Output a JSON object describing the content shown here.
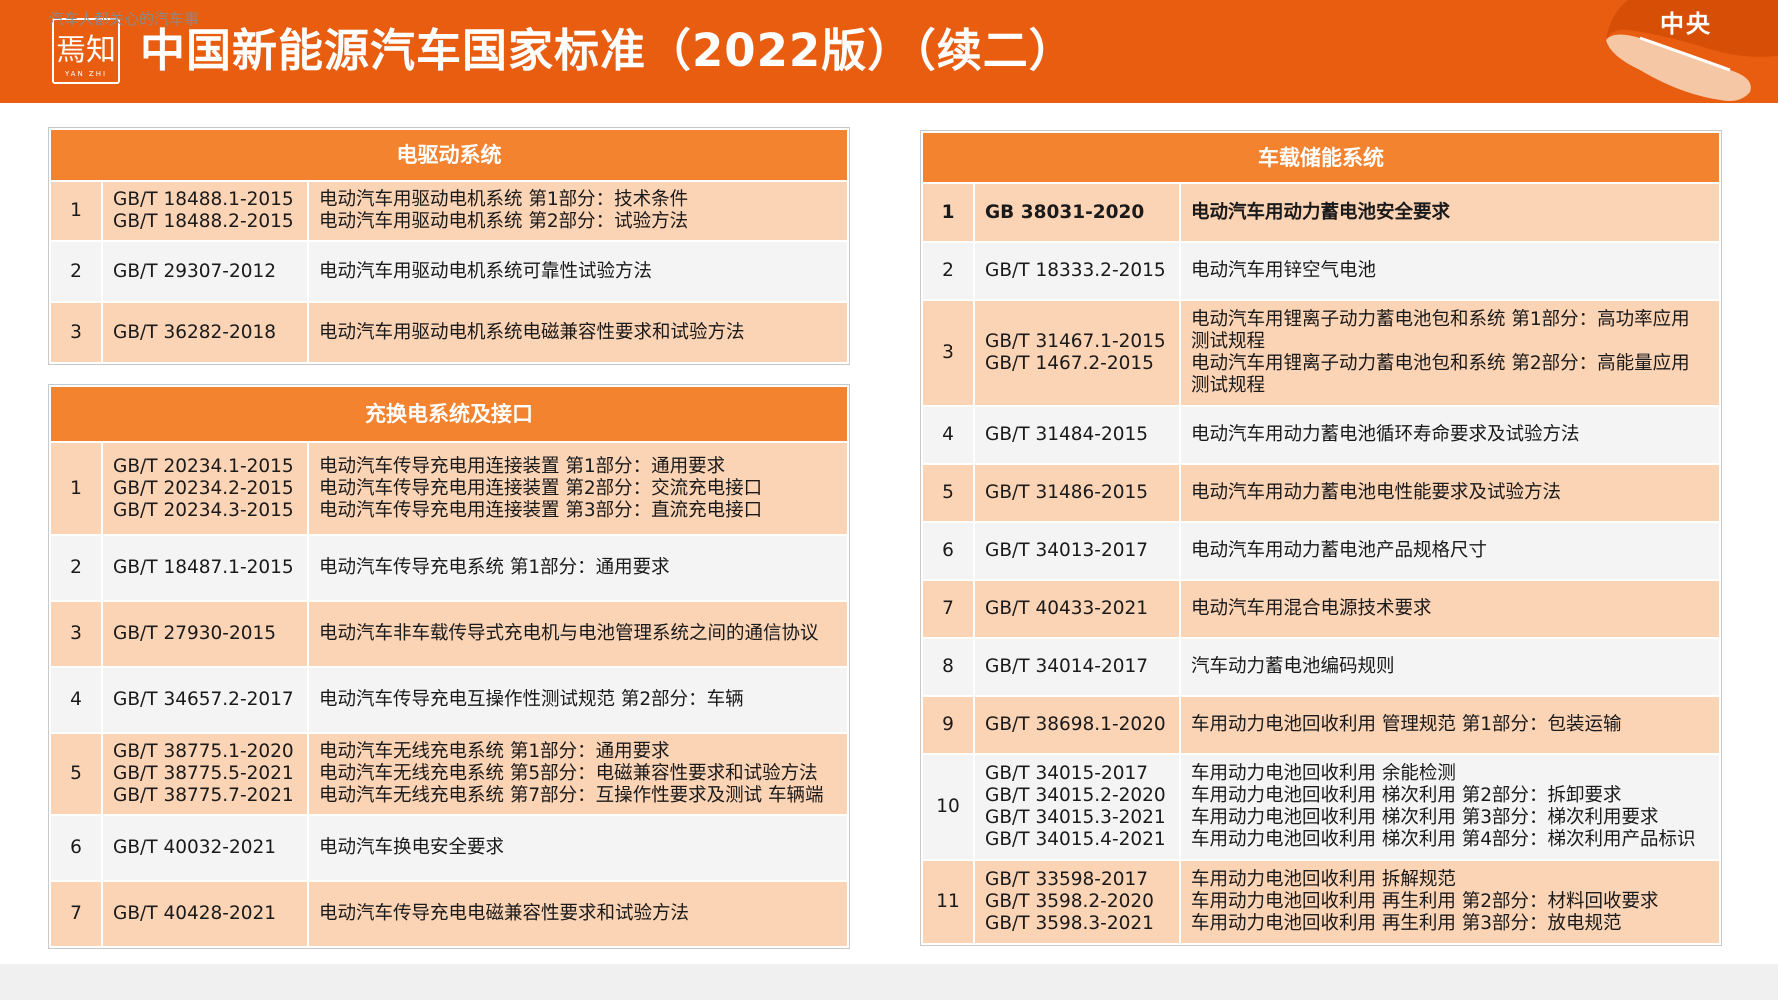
{
  "header": {
    "title": "中国新能源汽车国家标准（2022版）（续二）",
    "logo_text": "焉知",
    "logo_subtext": "YAN ZHI",
    "region_label": "中央",
    "bg_color": "#e85d10"
  },
  "tables": {
    "drive": {
      "heading": "电驱动系统",
      "rows": [
        {
          "no": "1",
          "codes": [
            "GB/T 18488.1-2015",
            "GB/T 18488.2-2015"
          ],
          "names": [
            "电动汽车用驱动电机系统 第1部分：技术条件",
            "电动汽车用驱动电机系统 第2部分：试验方法"
          ]
        },
        {
          "no": "2",
          "codes": [
            "GB/T 29307-2012"
          ],
          "names": [
            "电动汽车用驱动电机系统可靠性试验方法"
          ]
        },
        {
          "no": "3",
          "codes": [
            "GB/T 36282-2018"
          ],
          "names": [
            "电动汽车用驱动电机系统电磁兼容性要求和试验方法"
          ]
        }
      ]
    },
    "charging": {
      "heading": "充换电系统及接口",
      "rows": [
        {
          "no": "1",
          "codes": [
            "GB/T 20234.1-2015",
            "GB/T 20234.2-2015",
            "GB/T 20234.3-2015"
          ],
          "names": [
            "电动汽车传导充电用连接装置  第1部分：通用要求",
            "电动汽车传导充电用连接装置  第2部分：交流充电接口",
            "电动汽车传导充电用连接装置  第3部分：直流充电接口"
          ]
        },
        {
          "no": "2",
          "codes": [
            "GB/T 18487.1-2015"
          ],
          "names": [
            "电动汽车传导充电系统 第1部分：通用要求"
          ]
        },
        {
          "no": "3",
          "codes": [
            "GB/T 27930-2015"
          ],
          "names": [
            "电动汽车非车载传导式充电机与电池管理系统之间的通信协议"
          ]
        },
        {
          "no": "4",
          "codes": [
            "GB/T 34657.2-2017"
          ],
          "names": [
            "电动汽车传导充电互操作性测试规范  第2部分：车辆"
          ]
        },
        {
          "no": "5",
          "codes": [
            "GB/T 38775.1-2020",
            "GB/T 38775.5-2021",
            "GB/T  38775.7-2021"
          ],
          "names": [
            "电动汽车无线充电系统 第1部分：通用要求",
            "电动汽车无线充电系统  第5部分：电磁兼容性要求和试验方法",
            "电动汽车无线充电系统  第7部分：互操作性要求及测试 车辆端"
          ]
        },
        {
          "no": "6",
          "codes": [
            "GB/T 40032-2021"
          ],
          "names": [
            "电动汽车换电安全要求"
          ]
        },
        {
          "no": "7",
          "codes": [
            "GB/T 40428-2021"
          ],
          "names": [
            "电动汽车传导充电电磁兼容性要求和试验方法"
          ]
        }
      ]
    },
    "storage": {
      "heading": "车载储能系统",
      "rows": [
        {
          "no": "1",
          "codes": [
            "GB 38031-2020"
          ],
          "names": [
            "电动汽车用动力蓄电池安全要求"
          ],
          "bold": true
        },
        {
          "no": "2",
          "codes": [
            "GB/T 18333.2-2015"
          ],
          "names": [
            "电动汽车用锌空气电池"
          ]
        },
        {
          "no": "3",
          "codes": [
            "GB/T 31467.1-2015",
            "GB/T 1467.2-2015"
          ],
          "names": [
            "电动汽车用锂离子动力蓄电池包和系统  第1部分：高功率应用",
            "测试规程",
            "电动汽车用锂离子动力蓄电池包和系统  第2部分：高能量应用",
            "测试规程"
          ]
        },
        {
          "no": "4",
          "codes": [
            "GB/T 31484-2015"
          ],
          "names": [
            "电动汽车用动力蓄电池循环寿命要求及试验方法"
          ]
        },
        {
          "no": "5",
          "codes": [
            "GB/T 31486-2015"
          ],
          "names": [
            "电动汽车用动力蓄电池电性能要求及试验方法"
          ]
        },
        {
          "no": "6",
          "codes": [
            "GB/T 34013-2017"
          ],
          "names": [
            "电动汽车用动力蓄电池产品规格尺寸"
          ]
        },
        {
          "no": "7",
          "codes": [
            "GB/T 40433-2021"
          ],
          "names": [
            "电动汽车用混合电源技术要求"
          ]
        },
        {
          "no": "8",
          "codes": [
            "GB/T 34014-2017"
          ],
          "names": [
            "汽车动力蓄电池编码规则"
          ]
        },
        {
          "no": "9",
          "codes": [
            "GB/T 38698.1-2020"
          ],
          "names": [
            "车用动力电池回收利用 管理规范  第1部分：包装运输"
          ]
        },
        {
          "no": "10",
          "codes": [
            "GB/T 34015-2017",
            "GB/T 34015.2-2020",
            "GB/T 34015.3-2021",
            "GB/T 34015.4-2021"
          ],
          "names": [
            "车用动力电池回收利用 余能检测",
            "车用动力电池回收利用 梯次利用  第2部分：拆卸要求",
            "车用动力电池回收利用 梯次利用  第3部分：梯次利用要求",
            "车用动力电池回收利用 梯次利用  第4部分：梯次利用产品标识"
          ]
        },
        {
          "no": "11",
          "codes": [
            "GB/T 33598-2017",
            "GB/T 3598.2-2020",
            "GB/T 3598.3-2021"
          ],
          "names": [
            "车用动力电池回收利用 拆解规范",
            "车用动力电池回收利用 再生利用  第2部分：材料回收要求",
            "车用动力电池回收利用 再生利用  第3部分：放电规范"
          ]
        }
      ]
    }
  },
  "colors": {
    "heading_bg": "#f3832f",
    "row_odd_bg": "#fbd3b5",
    "row_even_bg": "#f4f4f4"
  },
  "footer": {
    "text": "汽车人都关心的汽车事"
  }
}
